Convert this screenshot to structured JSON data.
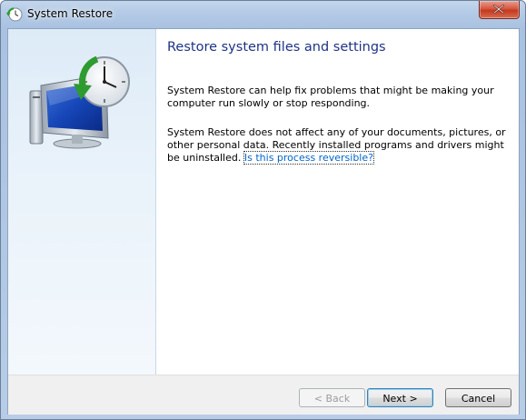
{
  "window": {
    "title": "System Restore",
    "icon": "system-restore-icon",
    "close_icon": "close-icon",
    "accent_color": "#1e3287",
    "link_color": "#0066cc"
  },
  "sidebar": {
    "graphic": "system-restore-graphic"
  },
  "main": {
    "heading": "Restore system files and settings",
    "paragraph1": "System Restore can help fix problems that might be making your computer run slowly or stop responding.",
    "paragraph2": "System Restore does not affect any of your documents, pictures, or other personal data. Recently installed programs and drivers might be uninstalled.",
    "link": "Is this process reversible?"
  },
  "buttons": {
    "back": "< Back",
    "next": "Next >",
    "cancel": "Cancel"
  }
}
